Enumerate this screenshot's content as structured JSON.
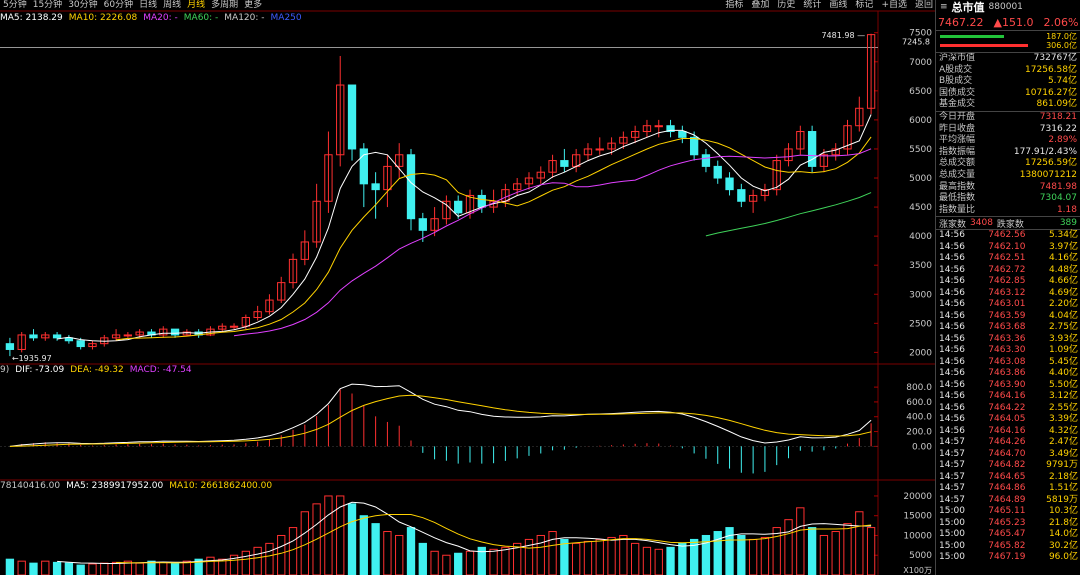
{
  "periods": [
    "5分钟",
    "15分钟",
    "30分钟",
    "60分钟",
    "日线",
    "周线",
    "月线",
    "多周期",
    "更多"
  ],
  "active_period": "月线",
  "tools": [
    "指标",
    "叠加",
    "历史",
    "统计",
    "画线",
    "标记",
    "+自选",
    "返回"
  ],
  "ma_legend": {
    "ma5": "MA5: 2138.29",
    "ma10": "MA10: 2226.08",
    "ma20": "MA20: -",
    "ma60": "MA60: -",
    "ma120": "MA120: -",
    "ma250": "MA250"
  },
  "ma_colors": {
    "ma5": "#ffffff",
    "ma10": "#ffd200",
    "ma20": "#e040ff",
    "ma60": "#3fd35a",
    "ma120": "#c8c8c8",
    "ma250": "#3d5cff"
  },
  "macd_legend": {
    "params": "9)",
    "dif": "DIF: -73.09",
    "dea": "DEA: -49.32",
    "macd": "MACD: -47.54"
  },
  "vol_legend": {
    "vol": "78140416.00",
    "ma5": "MA5: 2389917952.00",
    "ma10": "MA10: 2661862400.00"
  },
  "price_axis": [
    "7500",
    "7000",
    "6500",
    "6000",
    "5500",
    "5000",
    "4500",
    "4000",
    "3500",
    "3000",
    "2500",
    "2000"
  ],
  "price_line_label": "7245.8",
  "high_label": "7481.98",
  "low_label": "1935.97",
  "macd_axis": [
    "800.0",
    "600.0",
    "400.0",
    "200.0",
    "0.00"
  ],
  "vol_axis": [
    "20000",
    "15000",
    "10000",
    "5000"
  ],
  "vol_unit": "X100万",
  "symbol": {
    "name": "总市值",
    "code": "880001"
  },
  "quote": {
    "price": "7467.22",
    "change": "▲151.0",
    "pct": "2.06%"
  },
  "flow": {
    "buy": "187.0亿",
    "sell": "306.0亿"
  },
  "stats": [
    {
      "k": "沪深市值",
      "v": "732767亿",
      "c": "wht"
    },
    {
      "k": "A股成交",
      "v": "17256.58亿",
      "c": "yel"
    },
    {
      "k": "B股成交",
      "v": "5.74亿",
      "c": "yel"
    },
    {
      "k": "国债成交",
      "v": "10716.27亿",
      "c": "yel"
    },
    {
      "k": "基金成交",
      "v": "861.09亿",
      "c": "yel"
    }
  ],
  "stats2": [
    {
      "k": "今日开盘",
      "v": "7318.21",
      "c": "up"
    },
    {
      "k": "昨日收盘",
      "v": "7316.22",
      "c": "wht"
    },
    {
      "k": "平均涨幅",
      "v": "2.89%",
      "c": "up"
    },
    {
      "k": "指数振幅",
      "v": "177.91/2.43%",
      "c": "wht"
    },
    {
      "k": "总成交额",
      "v": "17256.59亿",
      "c": "yel"
    },
    {
      "k": "总成交量",
      "v": "1380071212",
      "c": "yel"
    },
    {
      "k": "最高指数",
      "v": "7481.98",
      "c": "up"
    },
    {
      "k": "最低指数",
      "v": "7304.07",
      "c": "dn"
    },
    {
      "k": "指数量比",
      "v": "1.18",
      "c": "up"
    }
  ],
  "updown": {
    "up_label": "涨家数",
    "up": "3408",
    "down_label": "跌家数",
    "down": "389"
  },
  "ticks": [
    {
      "t": "14:56",
      "p": "7462.56",
      "v": "5.34亿"
    },
    {
      "t": "14:56",
      "p": "7462.10",
      "v": "3.97亿"
    },
    {
      "t": "14:56",
      "p": "7462.51",
      "v": "4.16亿"
    },
    {
      "t": "14:56",
      "p": "7462.72",
      "v": "4.48亿"
    },
    {
      "t": "14:56",
      "p": "7462.85",
      "v": "4.66亿"
    },
    {
      "t": "14:56",
      "p": "7463.12",
      "v": "4.69亿"
    },
    {
      "t": "14:56",
      "p": "7463.01",
      "v": "2.20亿"
    },
    {
      "t": "14:56",
      "p": "7463.59",
      "v": "4.04亿"
    },
    {
      "t": "14:56",
      "p": "7463.68",
      "v": "2.75亿"
    },
    {
      "t": "14:56",
      "p": "7463.36",
      "v": "3.93亿"
    },
    {
      "t": "14:56",
      "p": "7463.30",
      "v": "1.09亿"
    },
    {
      "t": "14:56",
      "p": "7463.08",
      "v": "5.45亿"
    },
    {
      "t": "14:56",
      "p": "7463.86",
      "v": "4.40亿"
    },
    {
      "t": "14:56",
      "p": "7463.90",
      "v": "5.50亿"
    },
    {
      "t": "14:56",
      "p": "7464.16",
      "v": "3.12亿"
    },
    {
      "t": "14:56",
      "p": "7464.22",
      "v": "2.55亿"
    },
    {
      "t": "14:56",
      "p": "7464.05",
      "v": "3.39亿"
    },
    {
      "t": "14:56",
      "p": "7464.16",
      "v": "4.32亿"
    },
    {
      "t": "14:57",
      "p": "7464.26",
      "v": "2.47亿"
    },
    {
      "t": "14:57",
      "p": "7464.70",
      "v": "3.49亿"
    },
    {
      "t": "14:57",
      "p": "7464.82",
      "v": "9791万"
    },
    {
      "t": "14:57",
      "p": "7464.65",
      "v": "2.18亿"
    },
    {
      "t": "14:57",
      "p": "7464.86",
      "v": "1.51亿"
    },
    {
      "t": "14:57",
      "p": "7464.89",
      "v": "5819万"
    },
    {
      "t": "15:00",
      "p": "7465.11",
      "v": "10.3亿"
    },
    {
      "t": "15:00",
      "p": "7465.23",
      "v": "21.8亿"
    },
    {
      "t": "15:00",
      "p": "7465.47",
      "v": "14.0亿"
    },
    {
      "t": "15:00",
      "p": "7465.82",
      "v": "30.2亿"
    },
    {
      "t": "15:00",
      "p": "7467.19",
      "v": "96.0亿"
    }
  ],
  "chart_data": {
    "type": "candlestick",
    "count": 74,
    "open": [
      2150,
      2050,
      2300,
      2250,
      2300,
      2250,
      2200,
      2100,
      2150,
      2250,
      2300,
      2300,
      2350,
      2300,
      2400,
      2300,
      2350,
      2300,
      2400,
      2450,
      2450,
      2600,
      2700,
      2900,
      3200,
      3600,
      3900,
      4600,
      5400,
      6600,
      5500,
      4900,
      4800,
      5200,
      5400,
      4300,
      4100,
      4300,
      4600,
      4400,
      4700,
      4500,
      4600,
      4800,
      4900,
      5000,
      5100,
      5300,
      5200,
      5400,
      5500,
      5500,
      5600,
      5700,
      5800,
      5900,
      5900,
      5800,
      5700,
      5400,
      5200,
      5000,
      4800,
      4600,
      4700,
      4800,
      5300,
      5500,
      5800,
      5200,
      5400,
      5500,
      5900,
      6200
    ],
    "close": [
      2050,
      2300,
      2250,
      2300,
      2250,
      2200,
      2100,
      2150,
      2250,
      2300,
      2300,
      2350,
      2300,
      2400,
      2300,
      2350,
      2300,
      2400,
      2450,
      2450,
      2600,
      2700,
      2900,
      3200,
      3600,
      3900,
      4600,
      5400,
      6600,
      5500,
      4900,
      4800,
      5200,
      5400,
      4300,
      4100,
      4300,
      4600,
      4400,
      4700,
      4500,
      4600,
      4800,
      4900,
      5000,
      5100,
      5300,
      5200,
      5400,
      5500,
      5500,
      5600,
      5700,
      5800,
      5900,
      5900,
      5800,
      5700,
      5400,
      5200,
      5000,
      4800,
      4600,
      4700,
      4800,
      5300,
      5500,
      5800,
      5200,
      5400,
      5500,
      5900,
      6200,
      7467
    ],
    "high": [
      2250,
      2350,
      2400,
      2350,
      2350,
      2300,
      2250,
      2200,
      2300,
      2400,
      2350,
      2400,
      2400,
      2450,
      2400,
      2400,
      2400,
      2450,
      2500,
      2500,
      2650,
      2800,
      3000,
      3300,
      3700,
      4100,
      4900,
      5800,
      7100,
      6600,
      5600,
      5100,
      5400,
      5600,
      5500,
      4400,
      4500,
      4700,
      4700,
      4800,
      4800,
      4800,
      4900,
      5000,
      5100,
      5200,
      5400,
      5500,
      5500,
      5600,
      5700,
      5700,
      5800,
      5900,
      6000,
      6000,
      6000,
      5900,
      5800,
      5500,
      5300,
      5100,
      4900,
      4800,
      4900,
      5400,
      5600,
      5900,
      5900,
      5500,
      5600,
      6000,
      6400,
      7482
    ],
    "low": [
      1936,
      2000,
      2200,
      2200,
      2200,
      2150,
      2050,
      2050,
      2100,
      2200,
      2250,
      2250,
      2250,
      2250,
      2250,
      2280,
      2250,
      2280,
      2350,
      2400,
      2400,
      2550,
      2650,
      2850,
      3100,
      3500,
      3800,
      4400,
      5200,
      5300,
      4500,
      4300,
      4500,
      5000,
      4100,
      3900,
      4000,
      4200,
      4300,
      4300,
      4400,
      4400,
      4500,
      4700,
      4800,
      4900,
      5000,
      5100,
      5100,
      5300,
      5400,
      5400,
      5500,
      5600,
      5700,
      5700,
      5700,
      5600,
      5300,
      5100,
      4900,
      4700,
      4500,
      4400,
      4600,
      4700,
      5200,
      5400,
      5100,
      5100,
      5300,
      5400,
      5800,
      6100
    ],
    "volume": [
      4000,
      3500,
      3000,
      3500,
      3200,
      3000,
      2500,
      2800,
      3000,
      3200,
      3500,
      3000,
      3500,
      3200,
      3000,
      3500,
      4000,
      4500,
      4000,
      5000,
      6000,
      7000,
      8000,
      10000,
      12000,
      16000,
      18000,
      20000,
      20000,
      18000,
      15000,
      13000,
      11000,
      10000,
      12000,
      8000,
      6000,
      5000,
      5500,
      6000,
      7000,
      6500,
      7000,
      8000,
      9000,
      10000,
      11000,
      9000,
      8000,
      8500,
      9000,
      9500,
      10000,
      8000,
      7000,
      6500,
      7000,
      8000,
      9000,
      10000,
      11000,
      12000,
      10000,
      9000,
      9500,
      12000,
      14000,
      17000,
      12000,
      10000,
      11000,
      13000,
      16000,
      12000
    ],
    "price_range": [
      1800,
      7650
    ],
    "macd_range": [
      -400,
      950
    ],
    "vol_range": [
      0,
      21000
    ]
  }
}
